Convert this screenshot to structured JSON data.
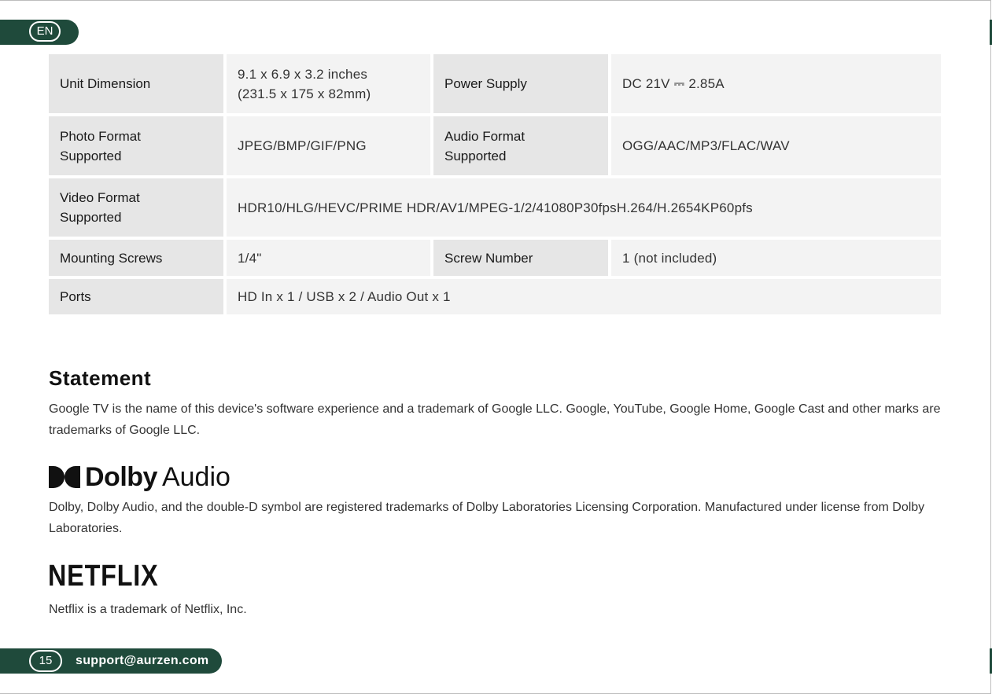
{
  "header": {
    "language": "EN"
  },
  "specs": {
    "unit_dimension": {
      "label": "Unit Dimension",
      "value_line1": "9.1 x 6.9 x 3.2 inches",
      "value_line2": "(231.5 x 175 x 82mm)"
    },
    "power_supply": {
      "label": "Power Supply",
      "value": "DC 21V  ⎓ 2.85A"
    },
    "photo_format": {
      "label_line1": "Photo Format",
      "label_line2": "Supported",
      "value": "JPEG/BMP/GIF/PNG"
    },
    "audio_format": {
      "label_line1": "Audio Format",
      "label_line2": "Supported",
      "value": "OGG/AAC/MP3/FLAC/WAV"
    },
    "video_format": {
      "label_line1": "Video Format",
      "label_line2": "Supported",
      "value": "HDR10/HLG/HEVC/PRIME HDR/AV1/MPEG-1/2/41080P30fpsH.264/H.2654KP60pfs"
    },
    "mounting_screws": {
      "label": "Mounting Screws",
      "value": "1/4\""
    },
    "screw_number": {
      "label": "Screw Number",
      "value": "1 (not included)"
    },
    "ports": {
      "label": "Ports",
      "value": "HD In x 1 / USB x 2 / Audio Out x 1"
    }
  },
  "statement": {
    "title": "Statement",
    "google_text": "Google TV is the name of this device's software experience and a trademark of Google LLC. Google, YouTube, Google Home, Google Cast and other marks are trademarks of Google LLC.",
    "dolby_logo_word": "Dolby",
    "dolby_logo_audio": "Audio",
    "dolby_text": "Dolby, Dolby Audio, and the double-D symbol are registered trademarks of Dolby Laboratories Licensing Corporation. Manufactured under license from Dolby Laboratories.",
    "netflix_logo": "NETFLIX",
    "netflix_text": "Netflix is a trademark of Netflix, Inc."
  },
  "footer": {
    "page_number": "15",
    "support_email": "support@aurzen.com"
  },
  "colors": {
    "brand_green": "#1f4a3b",
    "label_bg": "#e6e6e6",
    "value_bg": "#f3f3f3"
  }
}
